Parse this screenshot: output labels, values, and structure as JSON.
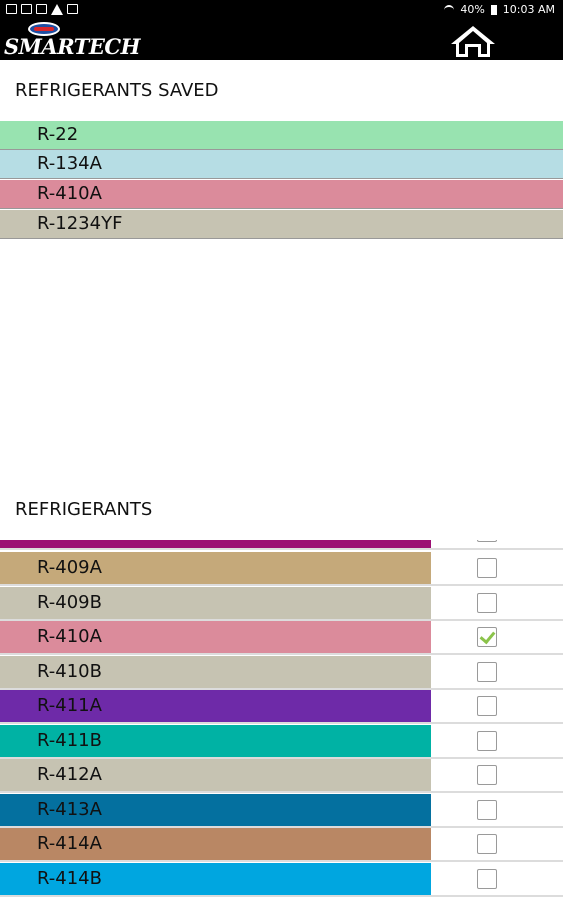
{
  "status": {
    "battery": "40%",
    "time": "10:03 AM"
  },
  "app": {
    "logo_text": "SMARTECH"
  },
  "saved_section": {
    "title": "REFRIGERANTS SAVED",
    "items": [
      {
        "label": "R-22",
        "color": "#98e3b0"
      },
      {
        "label": "R-134A",
        "color": "#b6dde4"
      },
      {
        "label": "R-410A",
        "color": "#db8b9b"
      },
      {
        "label": "R-1234YF",
        "color": "#c6c3b2"
      }
    ]
  },
  "list_section": {
    "title": "REFRIGERANTS",
    "items": [
      {
        "label": "",
        "color": "#9c0f74",
        "checked": false
      },
      {
        "label": "R-409A",
        "color": "#c5a97a",
        "checked": false
      },
      {
        "label": "R-409B",
        "color": "#c6c3b2",
        "checked": false
      },
      {
        "label": "R-410A",
        "color": "#db8b9b",
        "checked": true
      },
      {
        "label": "R-410B",
        "color": "#c6c3b2",
        "checked": false
      },
      {
        "label": "R-411A",
        "color": "#6e2aa8",
        "checked": false
      },
      {
        "label": "R-411B",
        "color": "#00b2a4",
        "checked": false
      },
      {
        "label": "R-412A",
        "color": "#c6c3b2",
        "checked": false
      },
      {
        "label": "R-413A",
        "color": "#04709f",
        "checked": false
      },
      {
        "label": "R-414A",
        "color": "#b98764",
        "checked": false
      },
      {
        "label": "R-414B",
        "color": "#00a6e0",
        "checked": false
      }
    ]
  }
}
